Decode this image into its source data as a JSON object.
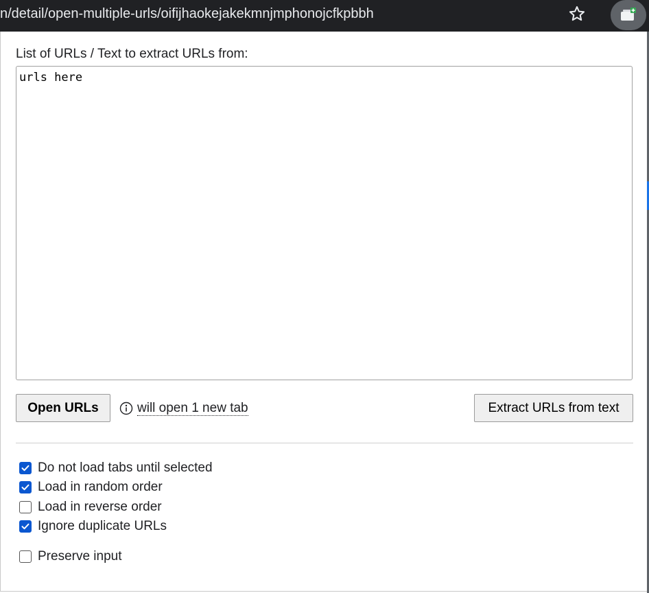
{
  "browser": {
    "url_text": "n/detail/open-multiple-urls/oifijhaokejakekmnjmphonojcfkpbbh"
  },
  "popup": {
    "urls_label": "List of URLs / Text to extract URLs from:",
    "urls_value": "urls here",
    "open_button": "Open URLs",
    "info_text": "will open 1 new tab",
    "extract_button": "Extract URLs from text",
    "options": [
      {
        "label": "Do not load tabs until selected",
        "checked": true
      },
      {
        "label": "Load in random order",
        "checked": true
      },
      {
        "label": "Load in reverse order",
        "checked": false
      },
      {
        "label": "Ignore duplicate URLs",
        "checked": true
      },
      {
        "label": "Preserve input",
        "checked": false
      }
    ]
  },
  "colors": {
    "checkbox_accent": "#0b57d0",
    "browser_bar": "#202124"
  }
}
